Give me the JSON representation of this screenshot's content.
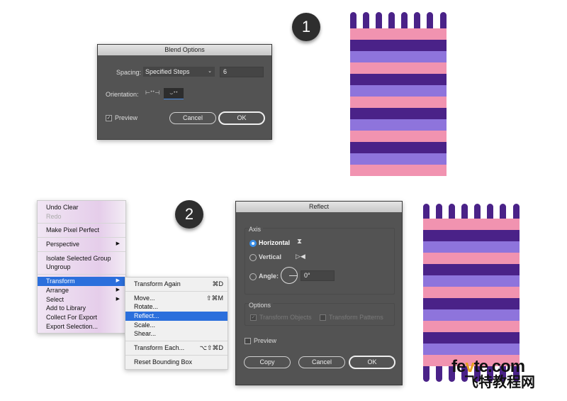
{
  "badges": [
    "1",
    "2"
  ],
  "blend_options": {
    "title": "Blend Options",
    "spacing_label": "Spacing:",
    "spacing_value": "Specified Steps",
    "steps_value": "6",
    "orientation_label": "Orientation:",
    "preview_label": "Preview",
    "preview_checked": true,
    "cancel": "Cancel",
    "ok": "OK"
  },
  "context_menu": {
    "items": [
      "Undo Clear",
      "Redo",
      "Make Pixel Perfect",
      "Perspective",
      "Isolate Selected Group",
      "Ungroup",
      "Transform",
      "Arrange",
      "Select",
      "Add to Library",
      "Collect For Export",
      "Export Selection..."
    ],
    "highlighted": "Transform"
  },
  "transform_submenu": {
    "items": [
      {
        "label": "Transform Again",
        "shortcut": "⌘D"
      },
      {
        "label": "Move...",
        "shortcut": "⇧⌘M"
      },
      {
        "label": "Rotate...",
        "shortcut": ""
      },
      {
        "label": "Reflect...",
        "shortcut": ""
      },
      {
        "label": "Scale...",
        "shortcut": ""
      },
      {
        "label": "Shear...",
        "shortcut": ""
      },
      {
        "label": "Transform Each...",
        "shortcut": "⌥⇧⌘D"
      },
      {
        "label": "Reset Bounding Box",
        "shortcut": ""
      }
    ],
    "highlighted": "Reflect..."
  },
  "reflect": {
    "title": "Reflect",
    "axis_label": "Axis",
    "horizontal": "Horizontal",
    "vertical": "Vertical",
    "angle_label": "Angle:",
    "angle_value": "0°",
    "selected_axis": "Horizontal",
    "options_label": "Options",
    "transform_objects": "Transform Objects",
    "transform_patterns": "Transform Patterns",
    "preview": "Preview",
    "copy": "Copy",
    "cancel": "Cancel",
    "ok": "OK"
  },
  "colors": {
    "pink": "#f193b0",
    "dark_purple": "#4a2288",
    "light_purple": "#8e74dc",
    "highlight": "#2b6fdc"
  },
  "watermark": {
    "line1": "fevte.com",
    "line2": "飞特教程网"
  }
}
